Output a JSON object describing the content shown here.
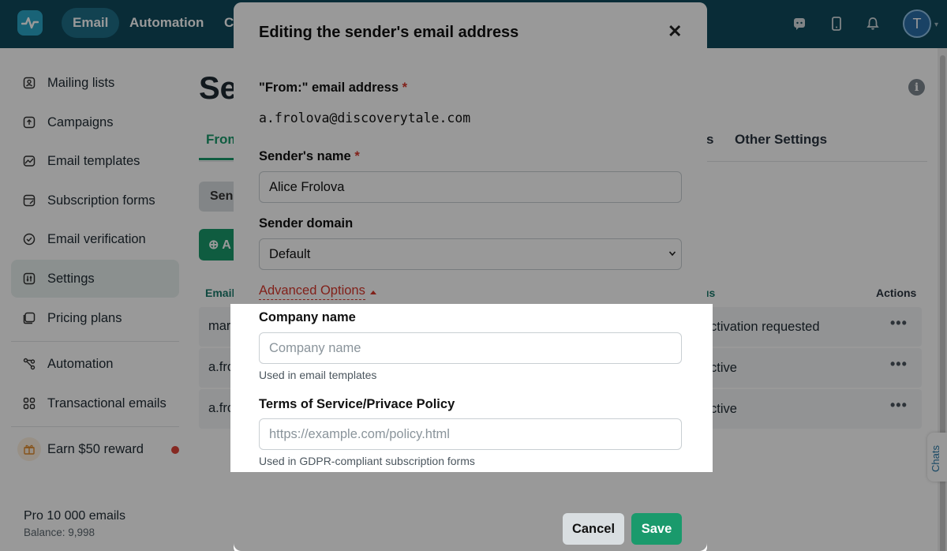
{
  "topbar": {
    "nav": [
      "Email",
      "Automation",
      "C"
    ],
    "avatar_letter": "T"
  },
  "sidebar": {
    "items": [
      {
        "label": "Mailing lists",
        "icon": "contacts-icon"
      },
      {
        "label": "Campaigns",
        "icon": "campaign-icon"
      },
      {
        "label": "Email templates",
        "icon": "template-icon"
      },
      {
        "label": "Subscription forms",
        "icon": "form-icon"
      },
      {
        "label": "Email verification",
        "icon": "verify-icon"
      },
      {
        "label": "Settings",
        "icon": "settings-icon"
      },
      {
        "label": "Pricing plans",
        "icon": "pricing-icon"
      },
      {
        "label": "Automation",
        "icon": "automation-icon"
      },
      {
        "label": "Transactional emails",
        "icon": "grid-icon"
      },
      {
        "label": "Earn $50 reward",
        "icon": "gift-icon"
      }
    ],
    "plan": "Pro 10 000 emails",
    "balance": "Balance: 9,998"
  },
  "main": {
    "title": "Se",
    "tabs": [
      "From",
      "s",
      "Other Settings"
    ],
    "sub_button": "Sen",
    "add_button": "A",
    "table": {
      "headers": [
        "Email",
        "us",
        "Actions"
      ],
      "rows": [
        {
          "email": "mark",
          "status": "ctivation requested"
        },
        {
          "email": "a.fro",
          "status": "ctive"
        },
        {
          "email": "a.fro",
          "status": "ctive"
        }
      ]
    },
    "chats_label": "Chats"
  },
  "modal": {
    "title": "Editing the sender's email address",
    "from_label": "\"From:\" email address",
    "from_value": "a.frolova@discoverytale.com",
    "name_label": "Sender's name",
    "name_value": "Alice Frolova",
    "domain_label": "Sender domain",
    "domain_value": "Default",
    "advanced_label": "Advanced Options",
    "company_label": "Company name",
    "company_placeholder": "Company name",
    "company_hint": "Used in email templates",
    "tos_label": "Terms of Service/Privace Policy",
    "tos_placeholder": "https://example.com/policy.html",
    "tos_hint": "Used in GDPR-compliant subscription forms",
    "cancel_label": "Cancel",
    "save_label": "Save",
    "required_mark": "*"
  },
  "colors": {
    "topbar": "#0f4a5c",
    "accent": "#1a9a6c",
    "required": "#d8372c"
  }
}
